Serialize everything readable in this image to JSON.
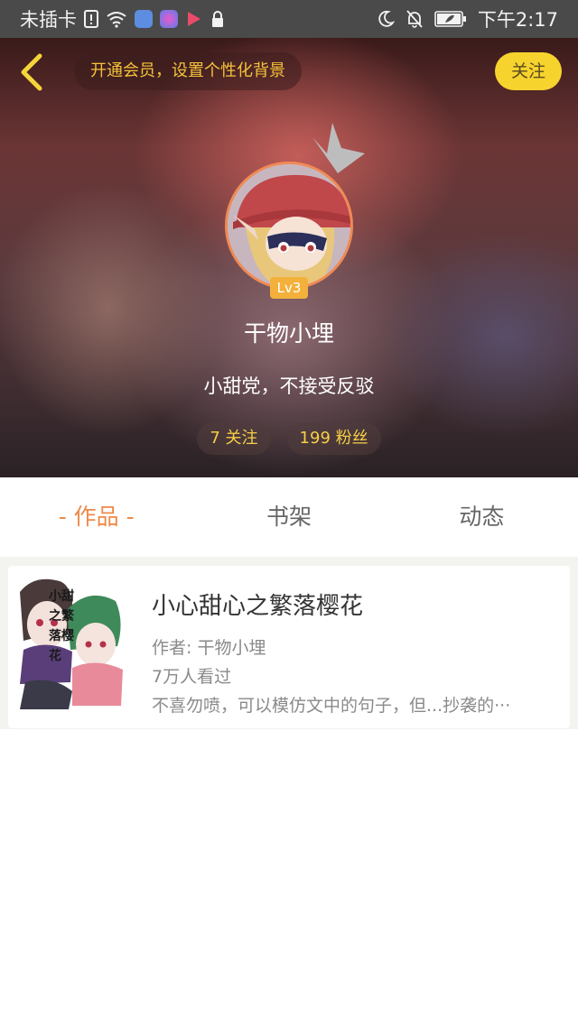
{
  "status_bar": {
    "carrier": "未插卡",
    "time": "下午2:17"
  },
  "header": {
    "back_icon": "chevron-left-icon",
    "vip_banner": "开通会员，设置个性化背景",
    "follow_label": "关注",
    "level": "Lv3",
    "username": "干物小埋",
    "signature": "小甜党，不接受反驳",
    "following": "7 关注",
    "followers": "199 粉丝"
  },
  "tabs": [
    {
      "label": "- 作品 -",
      "active": true
    },
    {
      "label": "书架",
      "active": false
    },
    {
      "label": "动态",
      "active": false
    }
  ],
  "works": [
    {
      "cover_text": "小甜之繁落樱花",
      "title": "小心甜心之繁落樱花",
      "author": "作者: 干物小埋",
      "views": "7万人看过",
      "description": "不喜勿喷，可以模仿文中的句子，但...抄袭的···"
    }
  ],
  "colors": {
    "accent_orange": "#ee8a4a",
    "follow_yellow": "#f7d32e",
    "level_badge": "#f3b13c",
    "stat_text": "#f7cf46"
  }
}
